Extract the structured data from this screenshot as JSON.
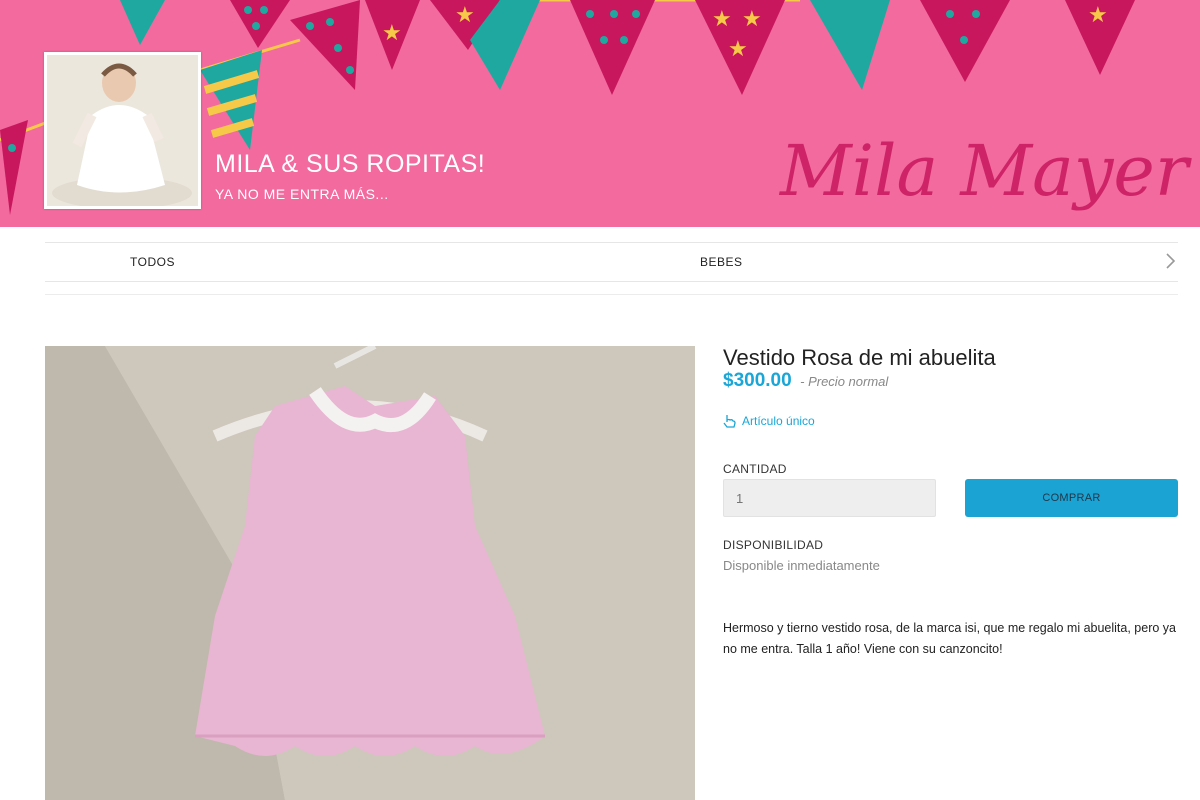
{
  "banner": {
    "store_title": "MILA & SUS ROPITAS!",
    "store_subtitle": "YA NO ME ENTRA MÁS...",
    "script_logo_text": "Mila Mayer",
    "background_color": "#f26a9e"
  },
  "nav": {
    "items": [
      {
        "label": "TODOS"
      },
      {
        "label": "BEBES"
      }
    ],
    "next_icon": "chevron-right-icon"
  },
  "product": {
    "title": "Vestido Rosa de mi abuelita",
    "price": "$300.00",
    "price_note": "- Precio normal",
    "unique_label": "Artículo único",
    "unique_icon": "pointer-hand-icon",
    "quantity_label": "CANTIDAD",
    "quantity_placeholder": "1",
    "buy_label": "COMPRAR",
    "availability_label": "DISPONIBILIDAD",
    "availability_value": "Disponible inmediatamente",
    "description": "Hermoso y tierno vestido rosa, de la marca isi, que me regalo mi abuelita, pero ya no me entra. Talla 1 año! Viene con su canzoncito!"
  },
  "colors": {
    "accent": "#1aa6d6",
    "banner_pink": "#f26a9e",
    "flag_magenta": "#c8175d",
    "flag_teal": "#1fa8a0",
    "flag_yellow": "#f7c948"
  }
}
